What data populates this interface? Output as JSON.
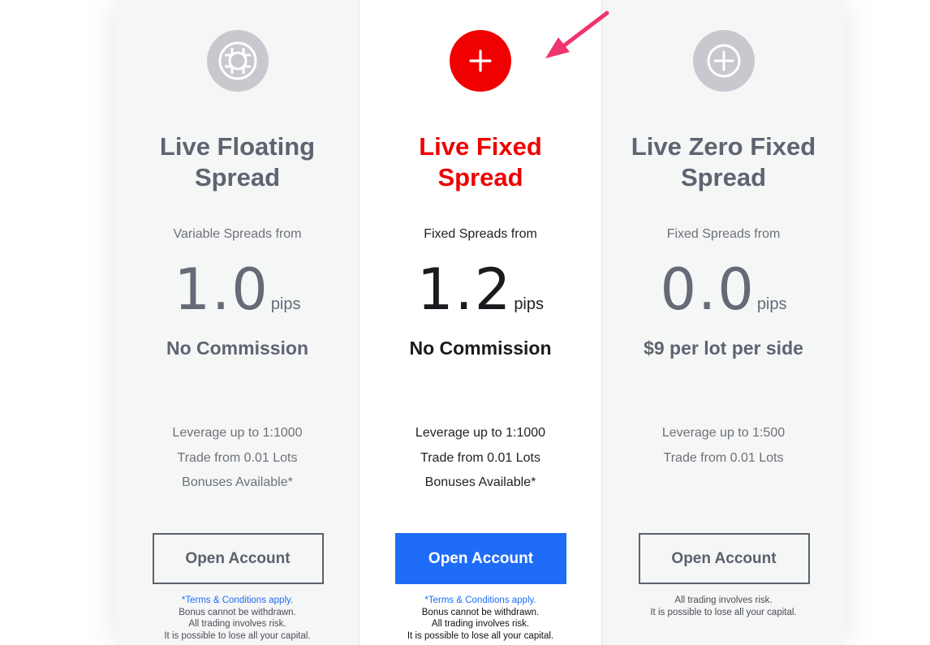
{
  "accounts": [
    {
      "icon": "lifebuoy-icon",
      "title_line1": "Live Floating",
      "title_line2": "Spread",
      "spread_label": "Variable Spreads from",
      "spread_value": "1.0",
      "spread_unit": "pips",
      "commission": "No Commission",
      "features": [
        "Leverage up to 1:1000",
        "Trade from 0.01 Lots",
        "Bonuses Available*"
      ],
      "button_label": "Open Account",
      "terms": "*Terms & Conditions apply.",
      "fine_print": [
        "Bonus cannot be withdrawn.",
        "All trading involves risk.",
        "It is possible to lose all your capital."
      ]
    },
    {
      "icon": "plus-icon",
      "title_line1": "Live Fixed",
      "title_line2": "Spread",
      "spread_label": "Fixed Spreads from",
      "spread_value": "1.2",
      "spread_unit": "pips",
      "commission": "No Commission",
      "features": [
        "Leverage up to 1:1000",
        "Trade from 0.01 Lots",
        "Bonuses Available*"
      ],
      "button_label": "Open Account",
      "terms": "*Terms & Conditions apply.",
      "fine_print": [
        "Bonus cannot be withdrawn.",
        "All trading involves risk.",
        "It is possible to lose all your capital."
      ]
    },
    {
      "icon": "plus-circle-icon",
      "title_line1": "Live Zero Fixed",
      "title_line2": "Spread",
      "spread_label": "Fixed Spreads from",
      "spread_value": "0.0",
      "spread_unit": "pips",
      "commission": "$9 per lot per side",
      "features": [
        "Leverage up to 1:500",
        "Trade from 0.01 Lots"
      ],
      "button_label": "Open Account",
      "fine_print": [
        "All trading involves risk.",
        "It is possible to lose all your capital."
      ]
    }
  ],
  "colors": {
    "accent_red": "#f00000",
    "button_blue": "#1e6cf7",
    "muted_text": "#606370",
    "annotation_arrow": "#f0356e"
  }
}
